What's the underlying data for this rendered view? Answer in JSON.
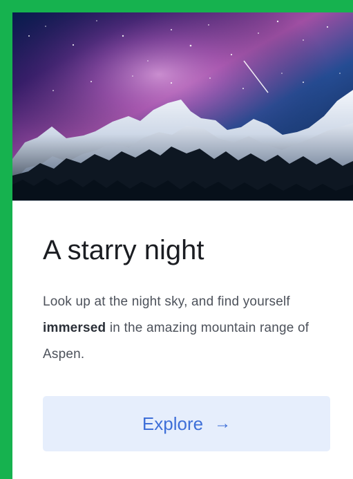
{
  "card": {
    "title": "A starry night",
    "description": {
      "before": "Look up at the night sky, and find yourself ",
      "emphasis": "immersed",
      "after": " in the amazing mountain range of Aspen."
    },
    "button": {
      "label": "Explore",
      "arrow": "→"
    }
  },
  "colors": {
    "frame": "#16b24f",
    "button_bg": "#e6eefc",
    "button_text": "#3e6fd8"
  },
  "icons": {
    "button_arrow": "arrow-right-icon"
  }
}
